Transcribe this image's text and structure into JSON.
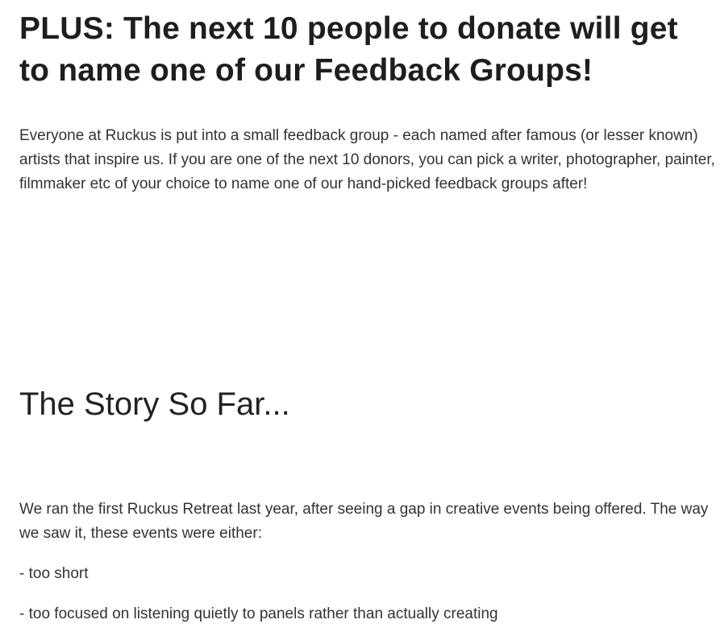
{
  "headline": "PLUS: The next 10 people to donate will get to name one of our Feedback Groups!",
  "intro_paragraph": "Everyone at Ruckus is put into a small feedback group - each named after famous (or lesser known) artists that inspire us. If you are one of the next 10 donors, you can pick a writer, photographer, painter, filmmaker etc of your choice to name one of our hand-picked feedback groups after!",
  "section_title": "The Story So Far...",
  "story_paragraph": "We ran the first Ruckus Retreat last year, after seeing a gap in creative events being offered. The way we saw it, these events were either:",
  "list_items": [
    "- too short",
    "- too focused on listening quietly to panels rather than actually creating"
  ]
}
